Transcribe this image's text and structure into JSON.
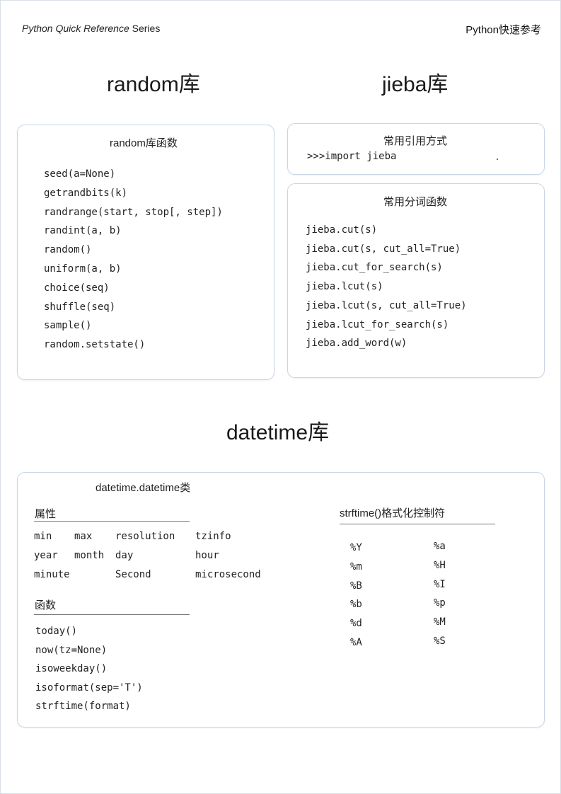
{
  "header": {
    "series_italic": "Python Quick Reference",
    "series_suffix": " Series",
    "right_title": "Python快速参考"
  },
  "random_section": {
    "title": "random库",
    "card_title": "random库函数",
    "functions": [
      "seed(a=None)",
      "getrandbits(k)",
      "randrange(start, stop[, step])",
      "randint(a, b)",
      "random()",
      "uniform(a, b)",
      "choice(seq)",
      "shuffle(seq)",
      "sample()",
      "random.setstate()"
    ]
  },
  "jieba_section": {
    "title": "jieba库",
    "import_card_title": "常用引用方式",
    "import_code": ">>>import jieba",
    "func_card_title": "常用分词函数",
    "functions": [
      "jieba.cut(s)",
      "jieba.cut(s, cut_all=True)",
      "jieba.cut_for_search(s)",
      "jieba.lcut(s)",
      "jieba.lcut(s, cut_all=True)",
      "jieba.lcut_for_search(s)",
      "jieba.add_word(w)"
    ]
  },
  "datetime_section": {
    "title": "datetime库",
    "card_title": "datetime.datetime类",
    "attributes_heading": "属性",
    "attributes": [
      [
        "min",
        "max",
        "resolution",
        "tzinfo"
      ],
      [
        "year",
        "month",
        "day",
        "hour"
      ],
      [
        "minute",
        "",
        "Second",
        "microsecond"
      ]
    ],
    "functions_heading": "函数",
    "functions": [
      "today()",
      "now(tz=None)",
      "isoweekday()",
      "isoformat(sep='T')",
      "strftime(format)"
    ],
    "strftime_heading": "strftime()格式化控制符",
    "strftime_col1": [
      "%Y",
      "%m",
      "%B",
      "%b",
      "%d",
      "%A"
    ],
    "strftime_col2": [
      "%a",
      "%H",
      "%I",
      "%p",
      "%M",
      "%S"
    ]
  }
}
